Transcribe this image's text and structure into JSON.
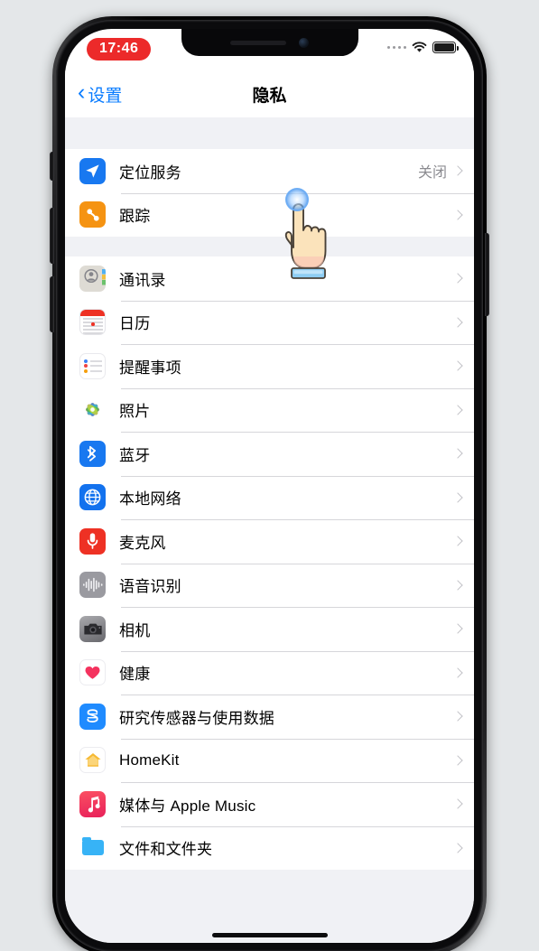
{
  "status_bar": {
    "time": "17:46",
    "time_badge_color": "#ec2a2a",
    "signal_icon": "cellular-dots-icon",
    "wifi_icon": "wifi-icon",
    "battery_icon": "battery-full-icon"
  },
  "nav_bar": {
    "back_label": "设置",
    "back_icon": "chevron-left-icon",
    "title": "隐私",
    "accent_color": "#0a7cff"
  },
  "groups": [
    {
      "rows": [
        {
          "icon": "location-arrow-icon",
          "label": "定位服务",
          "value": "关闭",
          "chevron": "chevron-right-icon"
        },
        {
          "icon": "tracking-icon",
          "label": "跟踪",
          "value": "",
          "chevron": "chevron-right-icon"
        }
      ]
    },
    {
      "rows": [
        {
          "icon": "contacts-icon",
          "label": "通讯录",
          "value": "",
          "chevron": "chevron-right-icon"
        },
        {
          "icon": "calendar-icon",
          "label": "日历",
          "value": "",
          "chevron": "chevron-right-icon"
        },
        {
          "icon": "reminders-icon",
          "label": "提醒事项",
          "value": "",
          "chevron": "chevron-right-icon"
        },
        {
          "icon": "photos-icon",
          "label": "照片",
          "value": "",
          "chevron": "chevron-right-icon"
        },
        {
          "icon": "bluetooth-icon",
          "label": "蓝牙",
          "value": "",
          "chevron": "chevron-right-icon"
        },
        {
          "icon": "local-network-icon",
          "label": "本地网络",
          "value": "",
          "chevron": "chevron-right-icon"
        },
        {
          "icon": "microphone-icon",
          "label": "麦克风",
          "value": "",
          "chevron": "chevron-right-icon"
        },
        {
          "icon": "speech-recognition-icon",
          "label": "语音识别",
          "value": "",
          "chevron": "chevron-right-icon"
        },
        {
          "icon": "camera-icon",
          "label": "相机",
          "value": "",
          "chevron": "chevron-right-icon"
        },
        {
          "icon": "health-icon",
          "label": "健康",
          "value": "",
          "chevron": "chevron-right-icon"
        },
        {
          "icon": "research-sensor-icon",
          "label": "研究传感器与使用数据",
          "value": "",
          "chevron": "chevron-right-icon"
        },
        {
          "icon": "homekit-icon",
          "label": "HomeKit",
          "value": "",
          "chevron": "chevron-right-icon"
        },
        {
          "icon": "apple-music-icon",
          "label": "媒体与 Apple Music",
          "value": "",
          "chevron": "chevron-right-icon"
        },
        {
          "icon": "files-folder-icon",
          "label": "文件和文件夹",
          "value": "",
          "chevron": "chevron-right-icon"
        }
      ]
    }
  ],
  "overlay": {
    "cursor_icon": "pointing-hand-cursor",
    "tap_indicator": "tap-ripple"
  },
  "device": {
    "notch_speaker": "speaker-grille",
    "notch_camera": "front-camera",
    "buttons": [
      "silent-switch",
      "volume-up-button",
      "volume-down-button",
      "power-button"
    ],
    "home_indicator": "home-indicator"
  }
}
